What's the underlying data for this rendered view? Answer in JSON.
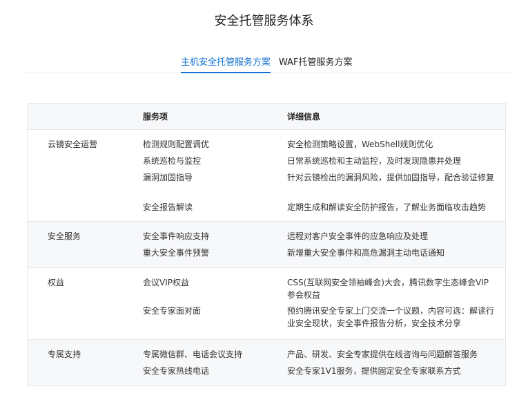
{
  "page": {
    "title": "安全托管服务体系"
  },
  "tabs": [
    {
      "label": "主机安全托管服务方案",
      "active": true
    },
    {
      "label": "WAF托管服务方案",
      "active": false
    }
  ],
  "accent_color": "#0d6fd0",
  "table": {
    "headers": [
      "",
      "服务项",
      "详细信息"
    ],
    "groups": [
      {
        "name": "云镜安全运营",
        "rows": [
          {
            "item": "检测规则配置调优",
            "detail": "安全检测策略设置，WebShell规则优化"
          },
          {
            "item": "系统巡检与监控",
            "detail": "日常系统巡检和主动监控，及时发现隐患并处理"
          },
          {
            "item": "漏洞加固指导",
            "detail": "针对云镜检出的漏洞风险，提供加固指导，配合验证修复"
          },
          {
            "item": "安全报告解读",
            "detail": "定期生成和解读安全防护报告，了解业务面临攻击趋势"
          }
        ]
      },
      {
        "name": "安全服务",
        "rows": [
          {
            "item": "安全事件响应支持",
            "detail": "远程对客户安全事件的应急响应及处理"
          },
          {
            "item": "重大安全事件预警",
            "detail": "新增重大安全事件和高危漏洞主动电话通知"
          }
        ]
      },
      {
        "name": "权益",
        "rows": [
          {
            "item": "会议VIP权益",
            "detail": "CSS(互联网安全领袖峰会)大会，腾讯数字生态峰会VIP参会权益"
          },
          {
            "item": "安全专家面对面",
            "detail": "预约腾讯安全专家上门交流一个议题，内容可选：解读行业安全现状，安全事件报告分析，安全技术分享"
          }
        ]
      },
      {
        "name": "专属支持",
        "rows": [
          {
            "item": "专属微信群、电话会议支持",
            "detail": "产品、研发、安全专家提供在线咨询与问题解答服务"
          },
          {
            "item": "安全专家热线电话",
            "detail": "安全专家1V1服务，提供固定安全专家联系方式"
          }
        ]
      }
    ]
  }
}
